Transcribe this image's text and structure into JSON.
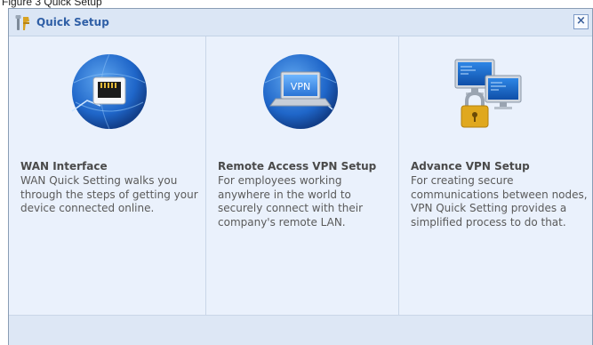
{
  "caption": "Figure 3 Quick Setup",
  "window": {
    "title": "Quick Setup",
    "close_glyph": "×",
    "title_icon": "wizard-tools-icon"
  },
  "cards": [
    {
      "title": "WAN Interface",
      "description": "WAN Quick Setting walks you through the steps of getting your device connected online.",
      "icon": "ethernet-globe-icon"
    },
    {
      "title": "Remote Access VPN Setup",
      "description": "For employees working anywhere in the world to securely connect with their company's remote LAN.",
      "icon": "laptop-vpn-globe-icon",
      "icon_text": "VPN"
    },
    {
      "title": "Advance VPN Setup",
      "description": "For creating secure communications between nodes, VPN Quick Setting provides a simplified process to do that.",
      "icon": "monitors-padlock-icon"
    }
  ],
  "colors": {
    "title_text": "#2f5fa6",
    "card_background": "#eaf1fc",
    "globe_blue": "#1f66c9",
    "padlock_gold": "#e0a81e"
  }
}
